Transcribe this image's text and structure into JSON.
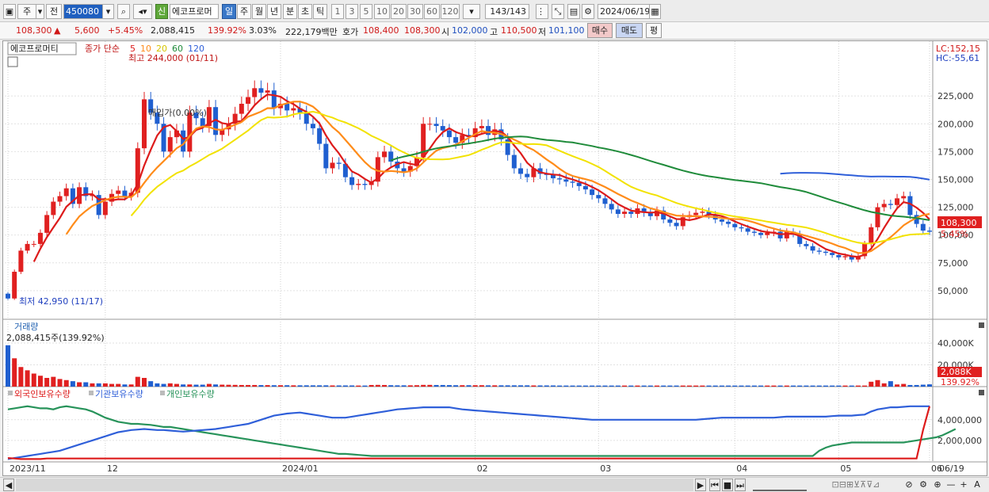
{
  "toolbar": {
    "period": "주",
    "prev": "전",
    "code": "450080",
    "name": "에코프로머",
    "new_badge": "신",
    "periods": [
      "일",
      "주",
      "월",
      "년",
      "분",
      "초",
      "틱"
    ],
    "active_period": "일",
    "ticks": [
      "1",
      "3",
      "5",
      "10",
      "20",
      "30",
      "60",
      "120"
    ],
    "count": "143/143",
    "date": "2024/06/19"
  },
  "quote": {
    "price": "108,300",
    "arrow": "▲",
    "change": "5,600",
    "change_pct": "+5.45%",
    "volume": "2,088,415",
    "volume_pct": "139.92%",
    "turnover": "3.03%",
    "amount": "222,179백만",
    "hoga_label": "호가",
    "hoga_ask": "108,400",
    "hoga_bid": "108,300",
    "open_label": "시",
    "open": "102,000",
    "high_label": "고",
    "high": "110,500",
    "low_label": "저",
    "low": "101,100",
    "buy": "매수",
    "sell": "매도",
    "avg": "평"
  },
  "chart_data": {
    "type": "candlestick",
    "title": "에코프로머티",
    "legend": {
      "label": "종가 단순",
      "mas": [
        "5",
        "10",
        "20",
        "60",
        "120"
      ],
      "colors": [
        "#dd1b1b",
        "#ff8c1a",
        "#f2e200",
        "#1f8b3a",
        "#2f5fd9"
      ]
    },
    "indicators": {
      "lc": "LC:152,15",
      "hc": "HC:-55,61"
    },
    "annotations": {
      "high": "최고 244,000 (01/11)",
      "low": "최저 42,950 (11/17)",
      "center_label": "매입가(0.00%)"
    },
    "price_ylim": [
      25000,
      260000
    ],
    "price_ticks": [
      "225,000",
      "200,000",
      "175,000",
      "150,000",
      "125,000",
      "100,000",
      "75,000",
      "50,000"
    ],
    "price_tick_values": [
      225000,
      200000,
      175000,
      150000,
      125000,
      100000,
      75000,
      50000
    ],
    "current_price_label": "108,300",
    "current_pct_label": "5.45%",
    "x_labels": [
      "2023/11",
      "12",
      "2024/01",
      "02",
      "03",
      "04",
      "05",
      "06",
      "06/19"
    ],
    "closes": [
      43000,
      67000,
      86000,
      92000,
      92000,
      102000,
      118000,
      130000,
      135000,
      142000,
      128000,
      143000,
      135000,
      136000,
      118000,
      130000,
      137000,
      140000,
      135000,
      138000,
      178000,
      222000,
      210000,
      200000,
      175000,
      188000,
      194000,
      175000,
      210000,
      205000,
      198000,
      215000,
      190000,
      195000,
      200000,
      209000,
      218000,
      224000,
      232000,
      228000,
      230000,
      214000,
      218000,
      212000,
      214000,
      210000,
      200000,
      196000,
      182000,
      160000,
      165000,
      164000,
      152000,
      145000,
      146000,
      145000,
      148000,
      170000,
      175000,
      166000,
      160000,
      157000,
      162000,
      170000,
      200000,
      200000,
      198000,
      194000,
      188000,
      183000,
      190000,
      188000,
      196000,
      198000,
      190000,
      195000,
      186000,
      172000,
      160000,
      155000,
      152000,
      160000,
      155000,
      154000,
      151000,
      150000,
      148000,
      147000,
      144000,
      141000,
      136000,
      133000,
      128000,
      123000,
      119000,
      121000,
      119000,
      124000,
      120000,
      117000,
      122000,
      114000,
      111000,
      108000,
      116000,
      118000,
      120000,
      121000,
      118000,
      114000,
      112000,
      110000,
      107000,
      106000,
      103000,
      102000,
      100000,
      102000,
      103000,
      97000,
      103000,
      101000,
      92000,
      90000,
      86000,
      85000,
      84000,
      82000,
      80000,
      81000,
      78000,
      81000,
      92000,
      107000,
      125000,
      128000,
      127000,
      133000,
      135000,
      118000,
      110000,
      104000,
      103000
    ],
    "volumes": [
      38000,
      26000,
      18000,
      15000,
      12000,
      10000,
      8000,
      9000,
      7000,
      6000,
      5000,
      4000,
      4000,
      3000,
      3000,
      3000,
      2500,
      2500,
      2000,
      2000,
      9000,
      8000,
      5000,
      3000,
      2500,
      3000,
      2500,
      2000,
      2000,
      1800,
      1800,
      2500,
      2000,
      1800,
      1700,
      1600,
      1500,
      1500,
      1500,
      1400,
      1400,
      1300,
      1300,
      1300,
      1200,
      1200,
      1200,
      1200,
      1200,
      1200,
      1100,
      1100,
      1100,
      1100,
      1000,
      1000,
      1500,
      1600,
      1500,
      1300,
      1200,
      1200,
      1200,
      1300,
      1600,
      1600,
      1500,
      1500,
      1400,
      1300,
      1300,
      1300,
      1300,
      1300,
      1200,
      1200,
      1200,
      1200,
      1200,
      1200,
      1200,
      1100,
      1100,
      1100,
      1100,
      1000,
      1000,
      1000,
      1000,
      1000,
      1000,
      1000,
      1000,
      1000,
      1000,
      1000,
      1000,
      1000,
      1000,
      1000,
      1000,
      1000,
      1000,
      1000,
      1000,
      1000,
      1000,
      1000,
      1000,
      1000,
      1000,
      1000,
      1000,
      1000,
      1000,
      1000,
      1000,
      1000,
      1000,
      1000,
      1000,
      1000,
      1000,
      1000,
      1000,
      1000,
      1000,
      1000,
      1000,
      1000,
      1000,
      1000,
      1000,
      4500,
      6000,
      3000,
      5000,
      2000,
      2500,
      1500,
      1500,
      1800,
      2100
    ],
    "volume_ylim": [
      0,
      48000
    ],
    "volume_ticks": [
      "40,000K",
      "20,000K"
    ],
    "volume_tick_values": [
      40000,
      20000
    ],
    "volume_title": "거래량",
    "volume_text": "2,088,415주(139.92%)",
    "volume_box": "2,088K",
    "volume_pct_box": "139.92%",
    "holdings": {
      "labels": [
        "외국인보유수량",
        "기관보유수량",
        "개인보유수량"
      ],
      "colors": [
        "#dd1b1b",
        "#2f5fd9",
        "#27935a"
      ],
      "ylim": [
        0,
        5900000
      ],
      "ticks": [
        "4,000,000",
        "2,000,000"
      ],
      "tick_values": [
        4000000,
        2000000
      ],
      "foreign": [
        300000,
        250000,
        200000,
        200000,
        200000,
        200000,
        250000,
        250000,
        250000,
        250000,
        250000,
        250000,
        250000,
        250000,
        250000,
        250000,
        250000,
        250000,
        250000,
        250000,
        250000,
        250000,
        250000,
        250000,
        250000,
        250000,
        250000,
        250000,
        250000,
        250000,
        250000,
        250000,
        250000,
        250000,
        250000,
        250000,
        250000,
        250000,
        250000,
        250000,
        250000,
        250000,
        250000,
        250000,
        250000,
        250000,
        250000,
        250000,
        250000,
        250000,
        250000,
        250000,
        250000,
        250000,
        250000,
        250000,
        250000,
        250000,
        250000,
        250000,
        250000,
        250000,
        250000,
        250000,
        250000,
        250000,
        250000,
        250000,
        250000,
        250000,
        250000,
        250000,
        250000,
        250000,
        250000,
        250000,
        250000,
        250000,
        250000,
        250000,
        250000,
        250000,
        250000,
        250000,
        250000,
        250000,
        250000,
        250000,
        250000,
        250000,
        250000,
        250000,
        250000,
        250000,
        250000,
        250000,
        250000,
        250000,
        250000,
        250000,
        250000,
        250000,
        250000,
        250000,
        250000,
        250000,
        250000,
        250000,
        250000,
        250000,
        250000,
        250000,
        250000,
        250000,
        250000,
        250000,
        250000,
        250000,
        250000,
        250000,
        250000,
        250000,
        250000,
        250000,
        250000,
        250000,
        250000,
        250000,
        250000,
        250000,
        250000,
        250000,
        250000,
        250000,
        250000,
        250000,
        250000,
        250000,
        250000,
        250000,
        250000,
        3000000,
        5300000
      ],
      "institution": [
        200000,
        300000,
        400000,
        500000,
        600000,
        700000,
        800000,
        900000,
        1000000,
        1200000,
        1400000,
        1600000,
        1800000,
        2000000,
        2200000,
        2400000,
        2600000,
        2800000,
        2900000,
        3000000,
        3050000,
        3100000,
        3050000,
        3000000,
        3000000,
        2950000,
        2900000,
        2850000,
        2900000,
        2950000,
        3000000,
        3050000,
        3100000,
        3200000,
        3300000,
        3400000,
        3500000,
        3600000,
        3800000,
        4000000,
        4200000,
        4400000,
        4500000,
        4600000,
        4650000,
        4700000,
        4600000,
        4500000,
        4400000,
        4300000,
        4200000,
        4200000,
        4200000,
        4300000,
        4400000,
        4500000,
        4600000,
        4700000,
        4800000,
        4900000,
        5000000,
        5050000,
        5100000,
        5150000,
        5200000,
        5200000,
        5200000,
        5200000,
        5200000,
        5100000,
        5000000,
        4950000,
        4900000,
        4850000,
        4800000,
        4750000,
        4700000,
        4650000,
        4600000,
        4550000,
        4500000,
        4450000,
        4400000,
        4350000,
        4300000,
        4250000,
        4200000,
        4150000,
        4100000,
        4050000,
        4000000,
        4000000,
        4000000,
        4000000,
        4000000,
        4000000,
        4000000,
        4000000,
        4000000,
        4000000,
        4000000,
        4000000,
        4000000,
        4000000,
        4000000,
        4000000,
        4000000,
        4050000,
        4100000,
        4150000,
        4200000,
        4200000,
        4200000,
        4200000,
        4200000,
        4200000,
        4200000,
        4200000,
        4200000,
        4250000,
        4300000,
        4300000,
        4300000,
        4300000,
        4300000,
        4300000,
        4300000,
        4350000,
        4400000,
        4400000,
        4400000,
        4450000,
        4500000,
        4800000,
        5000000,
        5100000,
        5200000,
        5200000,
        5250000,
        5300000,
        5300000,
        5300000,
        5300000
      ],
      "individual": [
        5000000,
        5100000,
        5200000,
        5300000,
        5200000,
        5100000,
        5100000,
        5000000,
        5200000,
        5300000,
        5200000,
        5100000,
        5000000,
        4800000,
        4500000,
        4200000,
        4000000,
        3800000,
        3700000,
        3600000,
        3600000,
        3550000,
        3500000,
        3400000,
        3300000,
        3300000,
        3200000,
        3100000,
        3000000,
        2900000,
        2800000,
        2700000,
        2600000,
        2500000,
        2400000,
        2300000,
        2200000,
        2100000,
        2000000,
        1900000,
        1800000,
        1700000,
        1600000,
        1500000,
        1400000,
        1300000,
        1200000,
        1100000,
        1000000,
        900000,
        800000,
        700000,
        700000,
        650000,
        600000,
        550000,
        500000,
        500000,
        500000,
        500000,
        500000,
        500000,
        500000,
        500000,
        500000,
        500000,
        500000,
        500000,
        500000,
        500000,
        500000,
        500000,
        500000,
        500000,
        500000,
        500000,
        500000,
        500000,
        500000,
        500000,
        500000,
        500000,
        500000,
        500000,
        500000,
        500000,
        500000,
        500000,
        500000,
        500000,
        500000,
        500000,
        500000,
        500000,
        500000,
        500000,
        500000,
        500000,
        500000,
        500000,
        500000,
        500000,
        500000,
        500000,
        500000,
        500000,
        500000,
        500000,
        500000,
        500000,
        500000,
        500000,
        500000,
        500000,
        500000,
        500000,
        500000,
        500000,
        500000,
        500000,
        500000,
        500000,
        500000,
        500000,
        500000,
        1000000,
        1300000,
        1500000,
        1600000,
        1700000,
        1800000,
        1800000,
        1800000,
        1800000,
        1800000,
        1800000,
        1800000,
        1800000,
        1800000,
        1900000,
        2000000,
        2100000,
        2200000,
        2300000,
        2500000,
        2800000,
        3100000
      ]
    }
  },
  "scroll": {
    "left": "◀",
    "right": "▶"
  }
}
